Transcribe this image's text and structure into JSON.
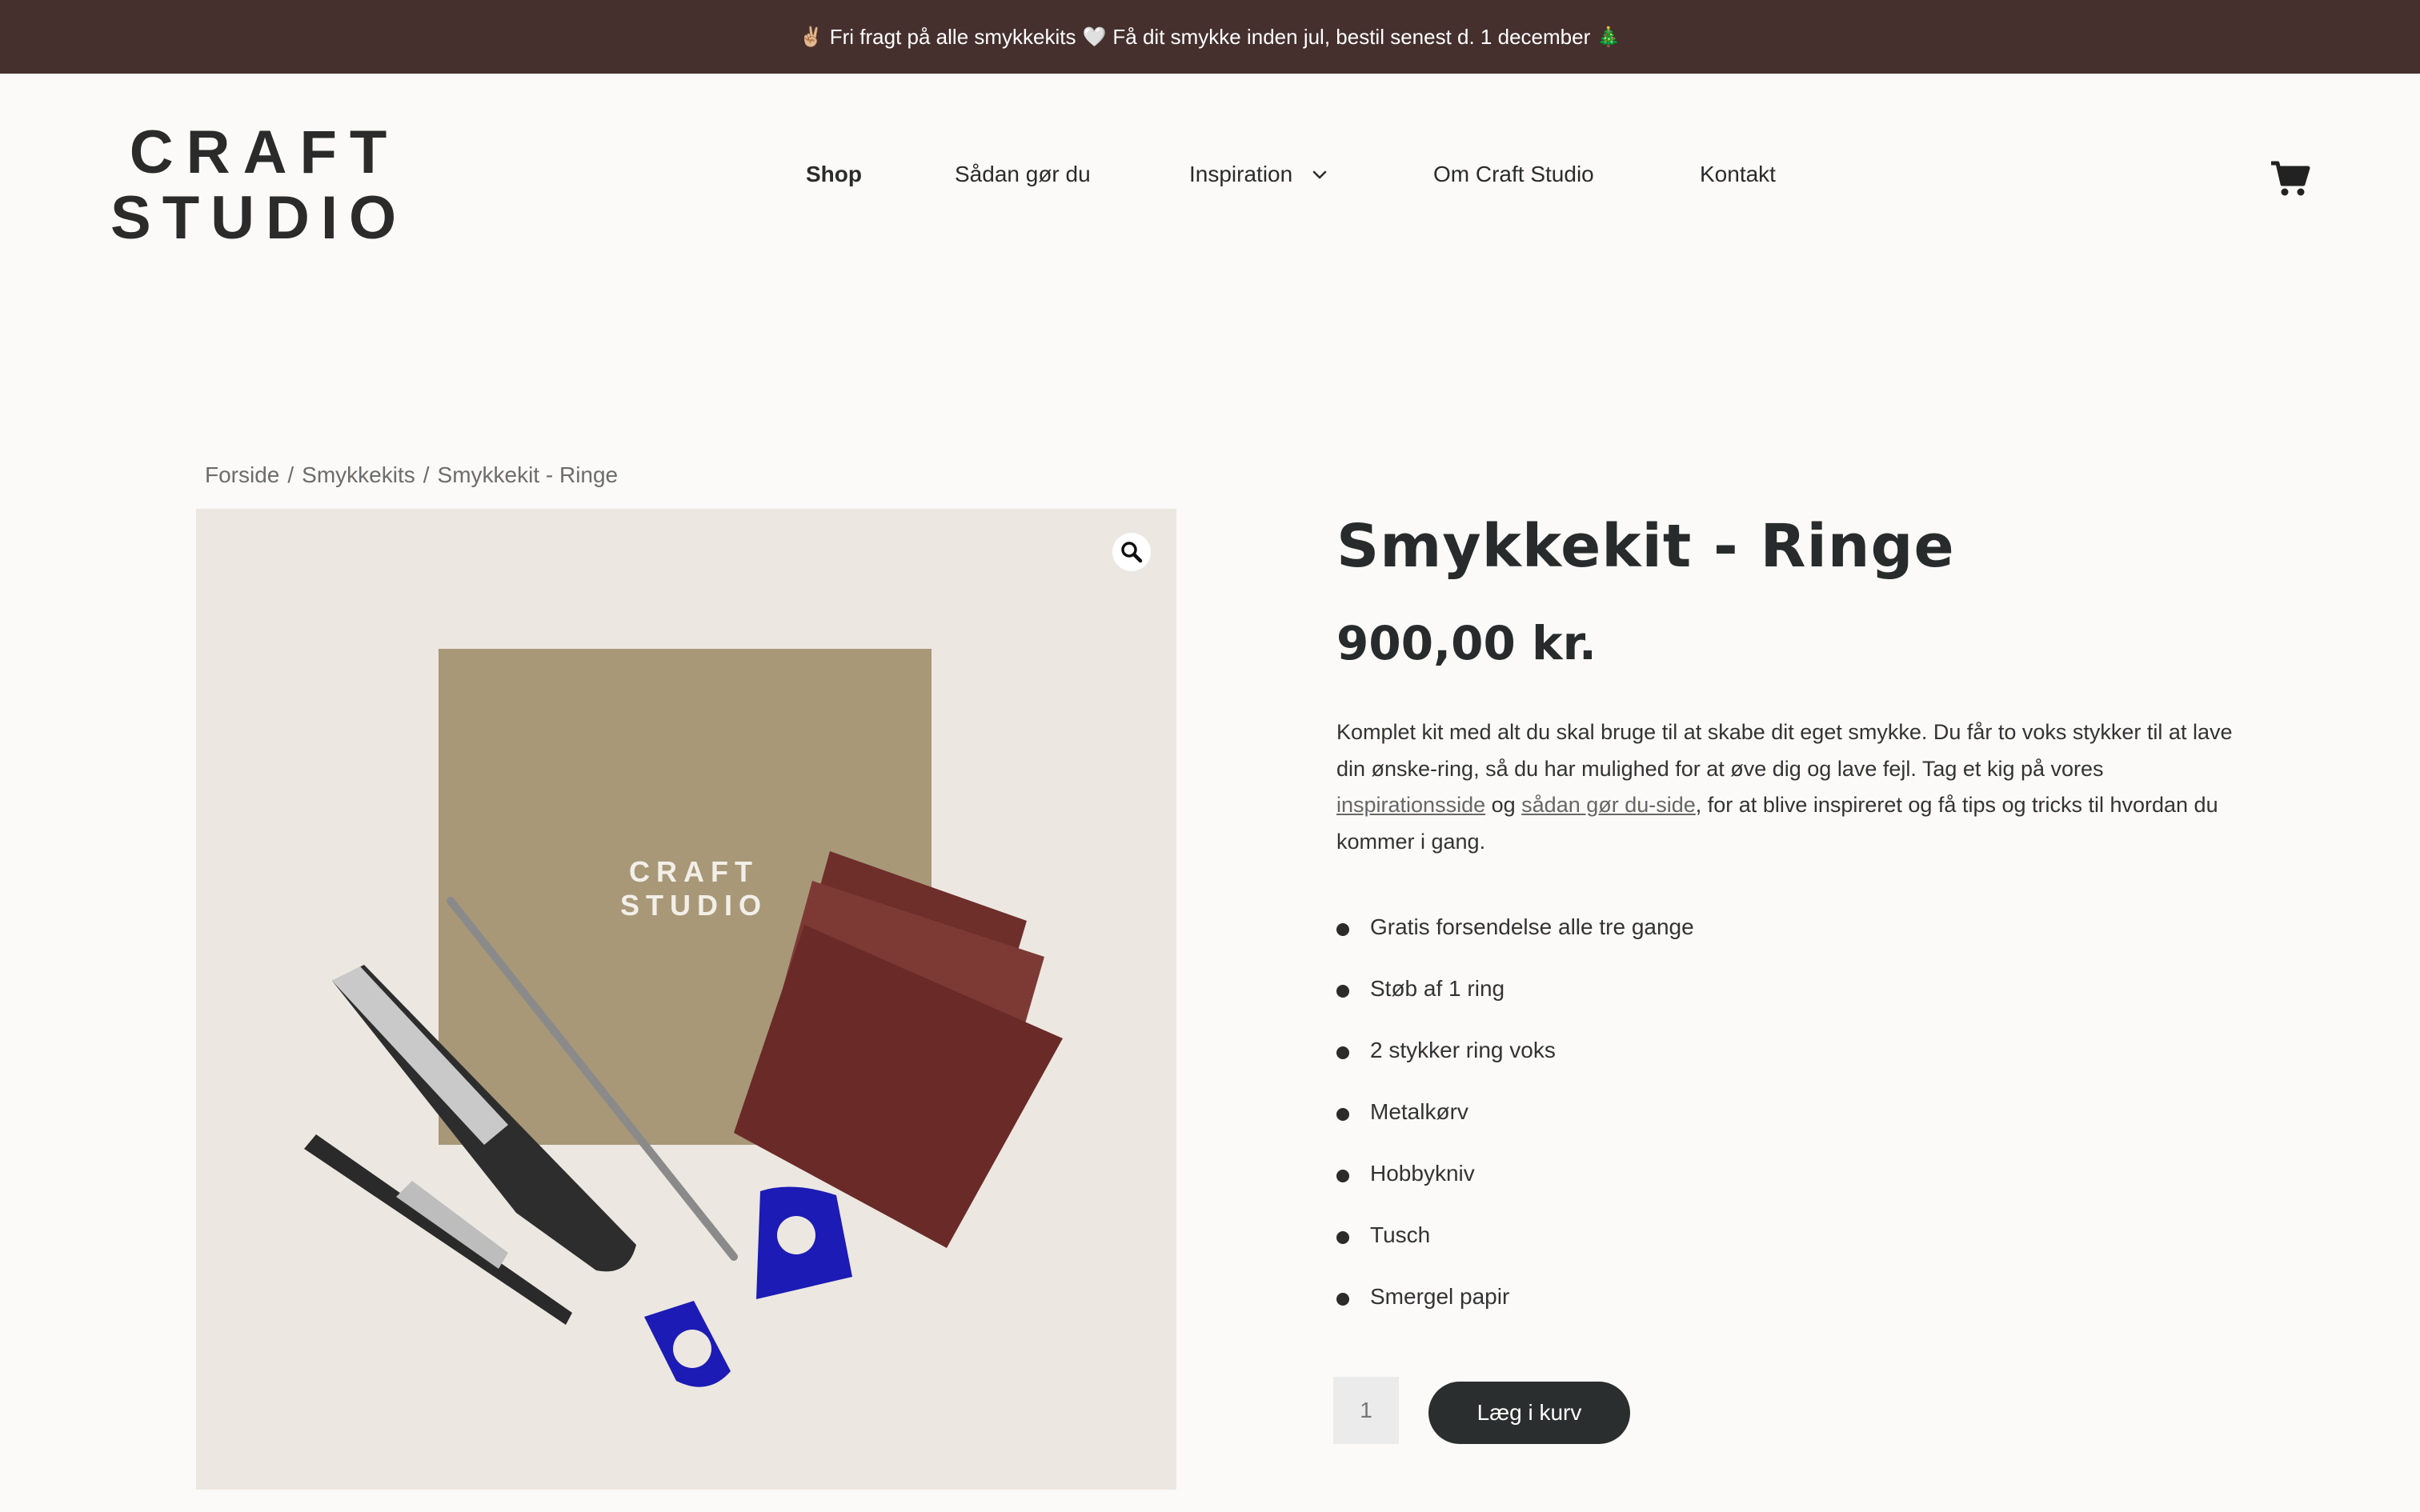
{
  "announcement": {
    "icon_left": "✌🏼",
    "text_part1": "Fri fragt på alle smykkekits",
    "icon_heart": "🤍",
    "text_part2": "Få dit smykke inden jul, bestil senest d. 1 december",
    "icon_right": "🎄"
  },
  "header": {
    "logo_line1": "CRAFT",
    "logo_line2": "STUDIO",
    "nav": [
      {
        "label": "Shop"
      },
      {
        "label": "Sådan gør du"
      },
      {
        "label": "Inspiration"
      },
      {
        "label": "Om Craft Studio"
      },
      {
        "label": "Kontakt"
      }
    ],
    "cart_icon": "cart-icon"
  },
  "breadcrumb": {
    "home": "Forside",
    "sep": "/",
    "category": "Smykkekits",
    "current": "Smykkekit - Ringe"
  },
  "gallery": {
    "zoom_icon": "magnifier-icon",
    "product_logo_line1": "CRAFT",
    "product_logo_line2": "STUDIO"
  },
  "product": {
    "title": "Smykkekit - Ringe",
    "price": "900,00 kr.",
    "desc_part1": "Komplet kit med alt du skal bruge til at skabe dit eget smykke. Du får to voks stykker til at lave din ønske-ring, så du har mulighed for at øve dig og lave fejl. Tag et kig på vores ",
    "link1": "inspirationsside",
    "desc_part2": " og ",
    "link2": "sådan gør du-side",
    "desc_part3": ", for at blive inspireret og få tips og tricks til hvordan du kommer i gang.",
    "features": [
      "Gratis forsendelse alle tre gange",
      "Støb af 1 ring",
      "2 stykker ring voks",
      "Metalkørv",
      "Hobbykniv",
      "Tusch",
      "Smergel papir"
    ],
    "quantity_placeholder": "1",
    "add_to_cart": "Læg i kurv"
  },
  "colors": {
    "topbar_bg": "#45302e",
    "page_bg": "#fbfaf8",
    "button_bg": "#2b2e2e",
    "image_bg": "#ece7e1"
  }
}
